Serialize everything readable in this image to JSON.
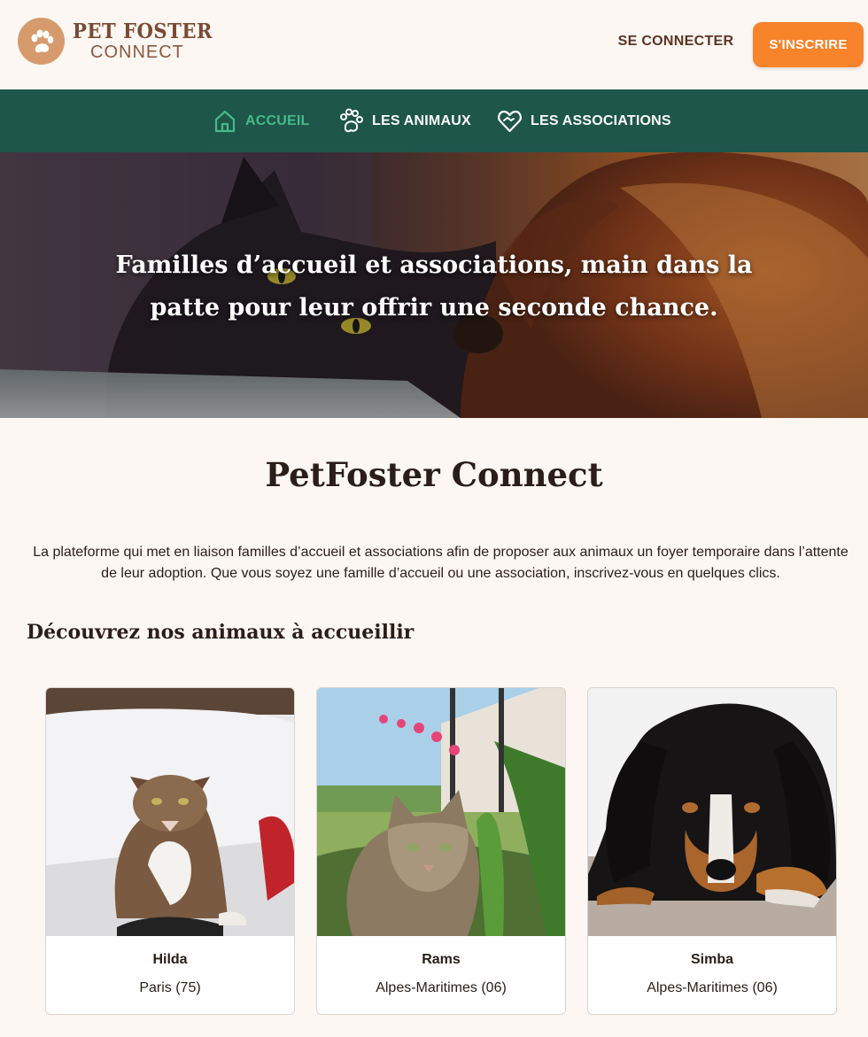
{
  "header": {
    "logo_line1": "PET FOSTER",
    "logo_line2": "CONNECT",
    "login_label": "SE CONNECTER",
    "signup_label": "S'INSCRIRE"
  },
  "nav": {
    "items": [
      {
        "label": "ACCUEIL",
        "icon": "home-icon",
        "active": true
      },
      {
        "label": "LES ANIMAUX",
        "icon": "paw-icon",
        "active": false
      },
      {
        "label": "LES ASSOCIATIONS",
        "icon": "heart-handshake-icon",
        "active": false
      }
    ]
  },
  "hero": {
    "tagline": "Familles d’accueil et associations, main dans la patte pour leur offrir une seconde chance."
  },
  "main": {
    "title": "PetFoster Connect",
    "intro": "La plateforme qui met en liaison familles d’accueil et associations afin de proposer aux animaux un foyer temporaire dans l’attente de leur adoption. Que vous soyez une famille d’accueil ou une association, inscrivez-vous en quelques clics.",
    "animals_heading": "Découvrez nos animaux à accueillir",
    "animals": [
      {
        "name": "Hilda",
        "location": "Paris (75)"
      },
      {
        "name": "Rams",
        "location": "Alpes-Maritimes (06)"
      },
      {
        "name": "Simba",
        "location": "Alpes-Maritimes (06)"
      }
    ]
  },
  "colors": {
    "background": "#fdf7f4",
    "nav_background": "#1e5649",
    "nav_active": "#46b98a",
    "signup_button": "#f7832b",
    "logo_brown": "#7a4b33"
  }
}
